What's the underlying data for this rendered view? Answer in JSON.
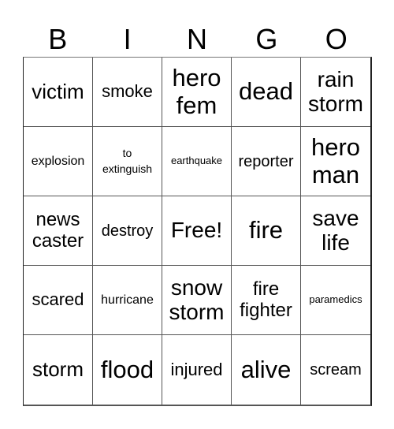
{
  "header": [
    "B",
    "I",
    "N",
    "G",
    "O"
  ],
  "cells": [
    {
      "text": "victim",
      "size": "s26"
    },
    {
      "text": "smoke",
      "size": "s22"
    },
    {
      "text": "hero fem",
      "size": "s30",
      "multi": true
    },
    {
      "text": "dead",
      "size": "s30"
    },
    {
      "text": "rain storm",
      "size": "s28",
      "multi": true
    },
    {
      "text": "explosion",
      "size": "s16"
    },
    {
      "text": "to extinguish",
      "size": "s14",
      "multi": true
    },
    {
      "text": "earthquake",
      "size": "s13"
    },
    {
      "text": "reporter",
      "size": "s20"
    },
    {
      "text": "hero man",
      "size": "s30",
      "multi": true
    },
    {
      "text": "news caster",
      "size": "s24",
      "multi": true
    },
    {
      "text": "destroy",
      "size": "s20"
    },
    {
      "text": "Free!",
      "size": "s28"
    },
    {
      "text": "fire",
      "size": "s30"
    },
    {
      "text": "save life",
      "size": "s28",
      "multi": true
    },
    {
      "text": "scared",
      "size": "s22"
    },
    {
      "text": "hurricane",
      "size": "s16"
    },
    {
      "text": "snow storm",
      "size": "s28",
      "multi": true
    },
    {
      "text": "fire fighter",
      "size": "s24",
      "multi": true
    },
    {
      "text": "paramedics",
      "size": "s13"
    },
    {
      "text": "storm",
      "size": "s26"
    },
    {
      "text": "flood",
      "size": "s30"
    },
    {
      "text": "injured",
      "size": "s22"
    },
    {
      "text": "alive",
      "size": "s30"
    },
    {
      "text": "scream",
      "size": "s20"
    }
  ]
}
